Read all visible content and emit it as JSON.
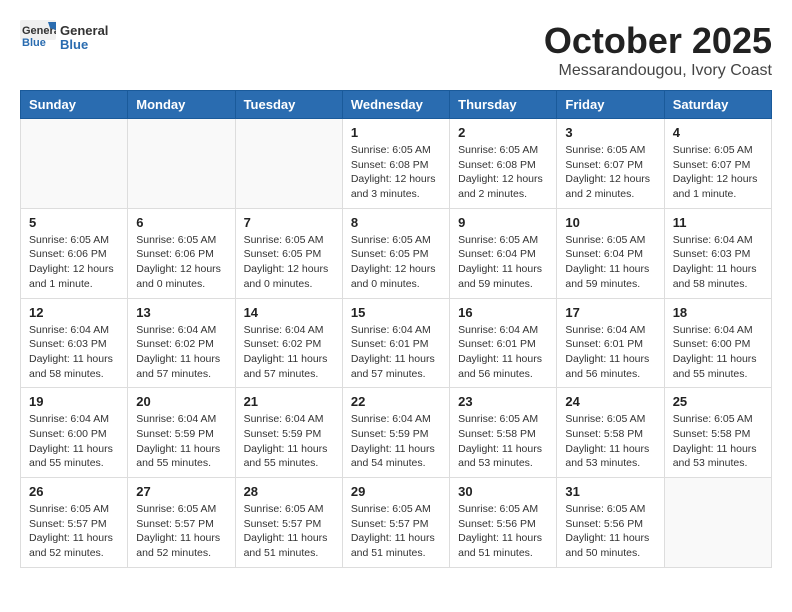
{
  "header": {
    "logo_general": "General",
    "logo_blue": "Blue",
    "month_title": "October 2025",
    "location": "Messarandougou, Ivory Coast"
  },
  "columns": [
    "Sunday",
    "Monday",
    "Tuesday",
    "Wednesday",
    "Thursday",
    "Friday",
    "Saturday"
  ],
  "weeks": [
    [
      {
        "day": "",
        "info": ""
      },
      {
        "day": "",
        "info": ""
      },
      {
        "day": "",
        "info": ""
      },
      {
        "day": "1",
        "info": "Sunrise: 6:05 AM\nSunset: 6:08 PM\nDaylight: 12 hours and 3 minutes."
      },
      {
        "day": "2",
        "info": "Sunrise: 6:05 AM\nSunset: 6:08 PM\nDaylight: 12 hours and 2 minutes."
      },
      {
        "day": "3",
        "info": "Sunrise: 6:05 AM\nSunset: 6:07 PM\nDaylight: 12 hours and 2 minutes."
      },
      {
        "day": "4",
        "info": "Sunrise: 6:05 AM\nSunset: 6:07 PM\nDaylight: 12 hours and 1 minute."
      }
    ],
    [
      {
        "day": "5",
        "info": "Sunrise: 6:05 AM\nSunset: 6:06 PM\nDaylight: 12 hours and 1 minute."
      },
      {
        "day": "6",
        "info": "Sunrise: 6:05 AM\nSunset: 6:06 PM\nDaylight: 12 hours and 0 minutes."
      },
      {
        "day": "7",
        "info": "Sunrise: 6:05 AM\nSunset: 6:05 PM\nDaylight: 12 hours and 0 minutes."
      },
      {
        "day": "8",
        "info": "Sunrise: 6:05 AM\nSunset: 6:05 PM\nDaylight: 12 hours and 0 minutes."
      },
      {
        "day": "9",
        "info": "Sunrise: 6:05 AM\nSunset: 6:04 PM\nDaylight: 11 hours and 59 minutes."
      },
      {
        "day": "10",
        "info": "Sunrise: 6:05 AM\nSunset: 6:04 PM\nDaylight: 11 hours and 59 minutes."
      },
      {
        "day": "11",
        "info": "Sunrise: 6:04 AM\nSunset: 6:03 PM\nDaylight: 11 hours and 58 minutes."
      }
    ],
    [
      {
        "day": "12",
        "info": "Sunrise: 6:04 AM\nSunset: 6:03 PM\nDaylight: 11 hours and 58 minutes."
      },
      {
        "day": "13",
        "info": "Sunrise: 6:04 AM\nSunset: 6:02 PM\nDaylight: 11 hours and 57 minutes."
      },
      {
        "day": "14",
        "info": "Sunrise: 6:04 AM\nSunset: 6:02 PM\nDaylight: 11 hours and 57 minutes."
      },
      {
        "day": "15",
        "info": "Sunrise: 6:04 AM\nSunset: 6:01 PM\nDaylight: 11 hours and 57 minutes."
      },
      {
        "day": "16",
        "info": "Sunrise: 6:04 AM\nSunset: 6:01 PM\nDaylight: 11 hours and 56 minutes."
      },
      {
        "day": "17",
        "info": "Sunrise: 6:04 AM\nSunset: 6:01 PM\nDaylight: 11 hours and 56 minutes."
      },
      {
        "day": "18",
        "info": "Sunrise: 6:04 AM\nSunset: 6:00 PM\nDaylight: 11 hours and 55 minutes."
      }
    ],
    [
      {
        "day": "19",
        "info": "Sunrise: 6:04 AM\nSunset: 6:00 PM\nDaylight: 11 hours and 55 minutes."
      },
      {
        "day": "20",
        "info": "Sunrise: 6:04 AM\nSunset: 5:59 PM\nDaylight: 11 hours and 55 minutes."
      },
      {
        "day": "21",
        "info": "Sunrise: 6:04 AM\nSunset: 5:59 PM\nDaylight: 11 hours and 55 minutes."
      },
      {
        "day": "22",
        "info": "Sunrise: 6:04 AM\nSunset: 5:59 PM\nDaylight: 11 hours and 54 minutes."
      },
      {
        "day": "23",
        "info": "Sunrise: 6:05 AM\nSunset: 5:58 PM\nDaylight: 11 hours and 53 minutes."
      },
      {
        "day": "24",
        "info": "Sunrise: 6:05 AM\nSunset: 5:58 PM\nDaylight: 11 hours and 53 minutes."
      },
      {
        "day": "25",
        "info": "Sunrise: 6:05 AM\nSunset: 5:58 PM\nDaylight: 11 hours and 53 minutes."
      }
    ],
    [
      {
        "day": "26",
        "info": "Sunrise: 6:05 AM\nSunset: 5:57 PM\nDaylight: 11 hours and 52 minutes."
      },
      {
        "day": "27",
        "info": "Sunrise: 6:05 AM\nSunset: 5:57 PM\nDaylight: 11 hours and 52 minutes."
      },
      {
        "day": "28",
        "info": "Sunrise: 6:05 AM\nSunset: 5:57 PM\nDaylight: 11 hours and 51 minutes."
      },
      {
        "day": "29",
        "info": "Sunrise: 6:05 AM\nSunset: 5:57 PM\nDaylight: 11 hours and 51 minutes."
      },
      {
        "day": "30",
        "info": "Sunrise: 6:05 AM\nSunset: 5:56 PM\nDaylight: 11 hours and 51 minutes."
      },
      {
        "day": "31",
        "info": "Sunrise: 6:05 AM\nSunset: 5:56 PM\nDaylight: 11 hours and 50 minutes."
      },
      {
        "day": "",
        "info": ""
      }
    ]
  ]
}
